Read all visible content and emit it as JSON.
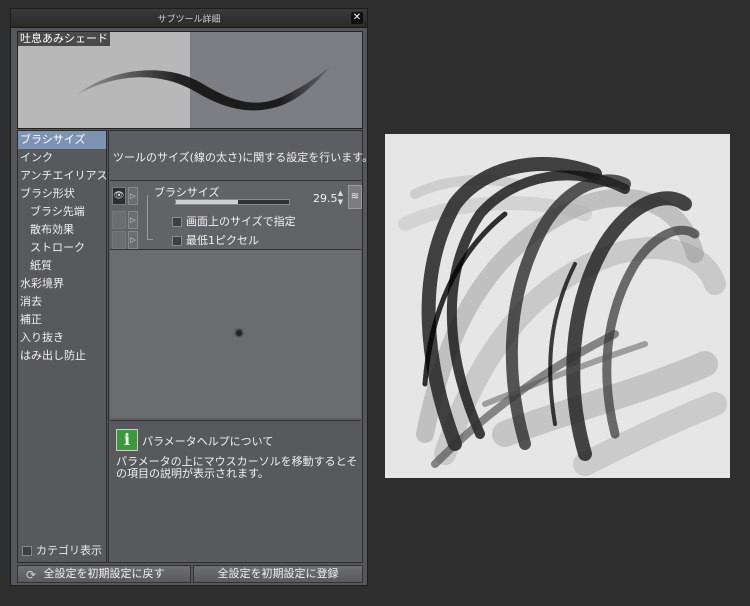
{
  "dialog": {
    "title": "サブツール詳細",
    "close_icon": "close-icon"
  },
  "preview": {
    "tool_name": "吐息あみシェード"
  },
  "categories": [
    {
      "label": "ブラシサイズ",
      "selected": true,
      "sub": false
    },
    {
      "label": "インク",
      "selected": false,
      "sub": false
    },
    {
      "label": "アンチエイリアス",
      "selected": false,
      "sub": false
    },
    {
      "label": "ブラシ形状",
      "selected": false,
      "sub": false
    },
    {
      "label": "ブラシ先端",
      "selected": false,
      "sub": true
    },
    {
      "label": "散布効果",
      "selected": false,
      "sub": true
    },
    {
      "label": "ストローク",
      "selected": false,
      "sub": true
    },
    {
      "label": "紙質",
      "selected": false,
      "sub": true
    },
    {
      "label": "水彩境界",
      "selected": false,
      "sub": false
    },
    {
      "label": "消去",
      "selected": false,
      "sub": false
    },
    {
      "label": "補正",
      "selected": false,
      "sub": false
    },
    {
      "label": "入り抜き",
      "selected": false,
      "sub": false
    },
    {
      "label": "はみ出し防止",
      "selected": false,
      "sub": false
    }
  ],
  "category_display": {
    "label": "カテゴリ表示",
    "checked": false
  },
  "description": "ツールのサイズ(線の太さ)に関する設定を行います。",
  "params": {
    "brush_size": {
      "label": "ブラシサイズ",
      "value": "29.5",
      "slider_fraction": 0.55
    },
    "screen_size": {
      "label": "画面上のサイズで指定",
      "checked": false
    },
    "min_1px": {
      "label": "最低1ピクセル",
      "checked": false
    }
  },
  "help": {
    "icon": "info-icon",
    "title": "パラメータヘルプについて",
    "text": "パラメータの上にマウスカーソルを移動するとその項目の説明が表示されます。"
  },
  "buttons": {
    "reset_all": "全設定を初期設定に戻す",
    "register_all": "全設定を初期設定に登録"
  }
}
